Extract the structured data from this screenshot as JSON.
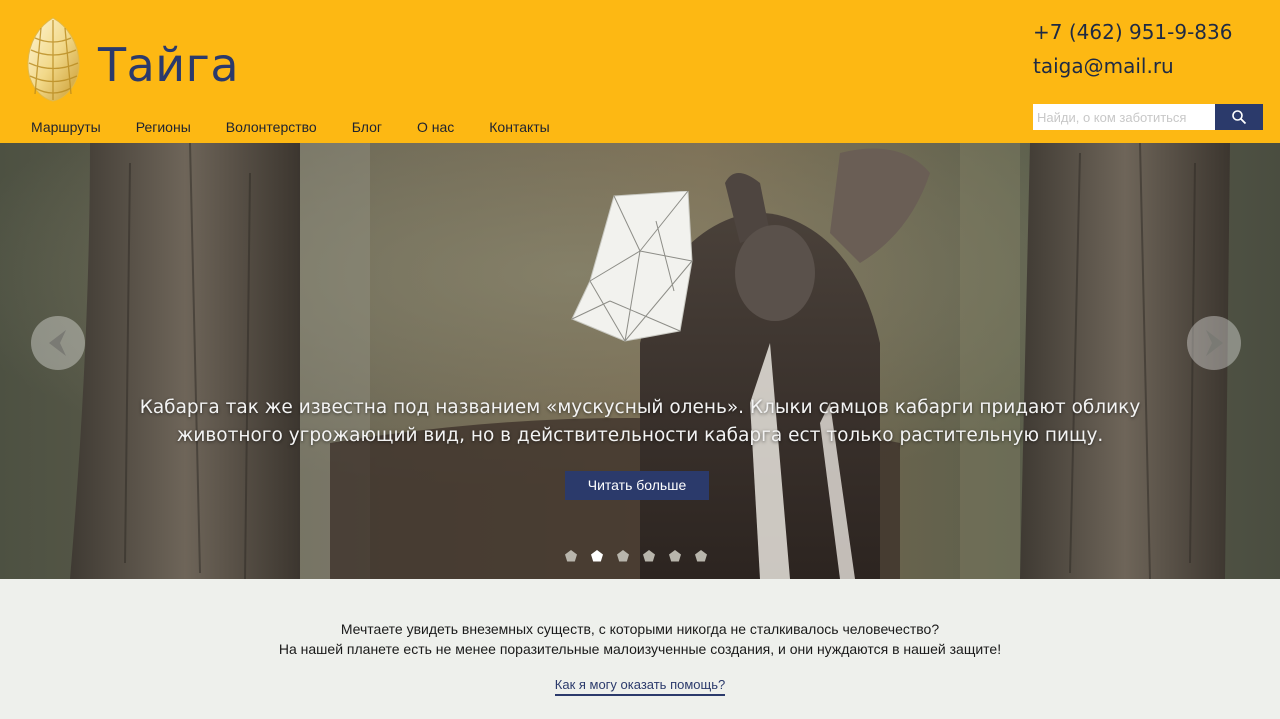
{
  "header": {
    "logo_text": "Тайга",
    "phone": "+7 (462) 951-9-836",
    "email": "taiga@mail.ru",
    "search": {
      "placeholder": "Найди, о ком заботиться",
      "button_icon": "search-icon"
    },
    "nav": [
      {
        "label": "Маршруты"
      },
      {
        "label": "Регионы"
      },
      {
        "label": "Волонтерство"
      },
      {
        "label": "Блог"
      },
      {
        "label": "О нас"
      },
      {
        "label": "Контакты"
      }
    ]
  },
  "slider": {
    "caption_line1": "Кабарга так же известна под названием «мускусный олень». Клыки самцов кабарги придают облику",
    "caption_line2": "животного угрожающий вид, но в действительности кабарга ест только растительную пищу.",
    "read_more": "Читать больше",
    "slide_count": 6,
    "active_slide": 2,
    "prev_icon": "chevron-left-icon",
    "next_icon": "chevron-right-icon"
  },
  "promo": {
    "line1": "Мечтаете увидеть внеземных существ, с которыми никогда не сталкивалось человечество?",
    "line2": "На нашей планете есть не менее поразительные малоизученные создания, и они нуждаются в нашей защите!",
    "link": "Как я могу оказать помощь?"
  },
  "colors": {
    "brand_yellow": "#fdb813",
    "brand_navy": "#2b3a6b",
    "page_bg": "#eef0ec"
  }
}
